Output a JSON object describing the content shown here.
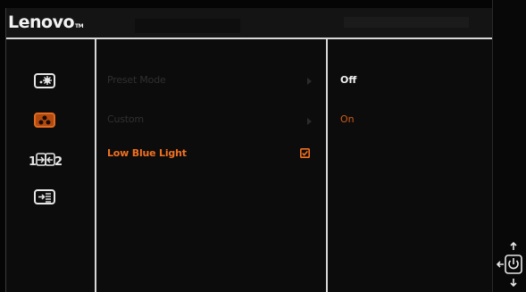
{
  "header": {
    "logo_text": "Lenovo",
    "logo_mark": "TM"
  },
  "sidebar_icons": [
    {
      "name": "brightness-contrast-icon",
      "state": "normal"
    },
    {
      "name": "image-color-icon",
      "state": "active"
    },
    {
      "name": "input-source-icon",
      "state": "normal"
    },
    {
      "name": "menu-settings-icon",
      "state": "normal"
    }
  ],
  "menu": {
    "items": [
      {
        "label": "Preset Mode",
        "state": "disabled",
        "has_submenu": true
      },
      {
        "label": "Custom",
        "state": "disabled",
        "has_submenu": true
      },
      {
        "label": "Low Blue Light",
        "state": "selected",
        "checked": true
      }
    ]
  },
  "options": {
    "items": [
      {
        "label": "Off",
        "state": "highlighted"
      },
      {
        "label": "On",
        "state": "normal"
      }
    ]
  },
  "colors": {
    "accent": "#f07020",
    "text": "#f2f2f2",
    "divider": "#d8d8d8",
    "disabled": "#303030",
    "background": "#0c0c0c"
  },
  "nav_icon": "joystick-power-icon"
}
